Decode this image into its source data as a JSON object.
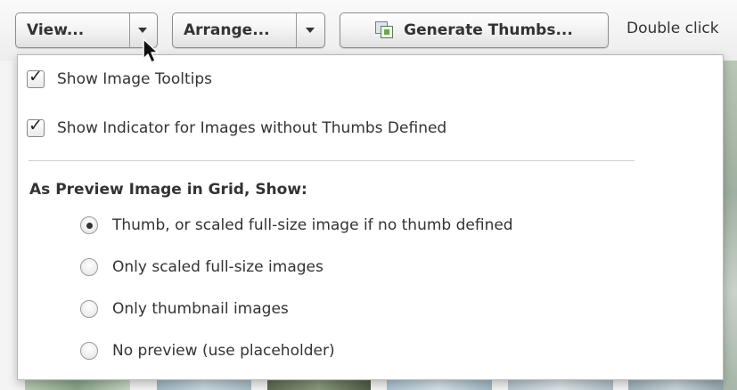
{
  "toolbar": {
    "view_label": "View...",
    "arrange_label": "Arrange...",
    "generate_label": "Generate Thumbs...",
    "hint_text": "Double click"
  },
  "menu": {
    "checkboxes": [
      {
        "label": "Show Image Tooltips",
        "checked": true
      },
      {
        "label": "Show Indicator for Images without Thumbs Defined",
        "checked": true
      }
    ],
    "section_title": "As Preview Image in Grid, Show:",
    "radio_options": [
      {
        "label": "Thumb, or scaled full-size image if no thumb defined",
        "selected": true
      },
      {
        "label": "Only scaled full-size images",
        "selected": false
      },
      {
        "label": "Only thumbnail images",
        "selected": false
      },
      {
        "label": "No preview (use placeholder)",
        "selected": false
      }
    ]
  },
  "icons": {
    "dropdown_arrow": "chevron-down-icon",
    "generate": "thumbnails-icon",
    "check": "checkmark-icon",
    "cursor": "mouse-pointer-icon"
  },
  "colors": {
    "button_border": "#8e8e8e",
    "menu_background": "#ffffff",
    "text": "#333333"
  }
}
